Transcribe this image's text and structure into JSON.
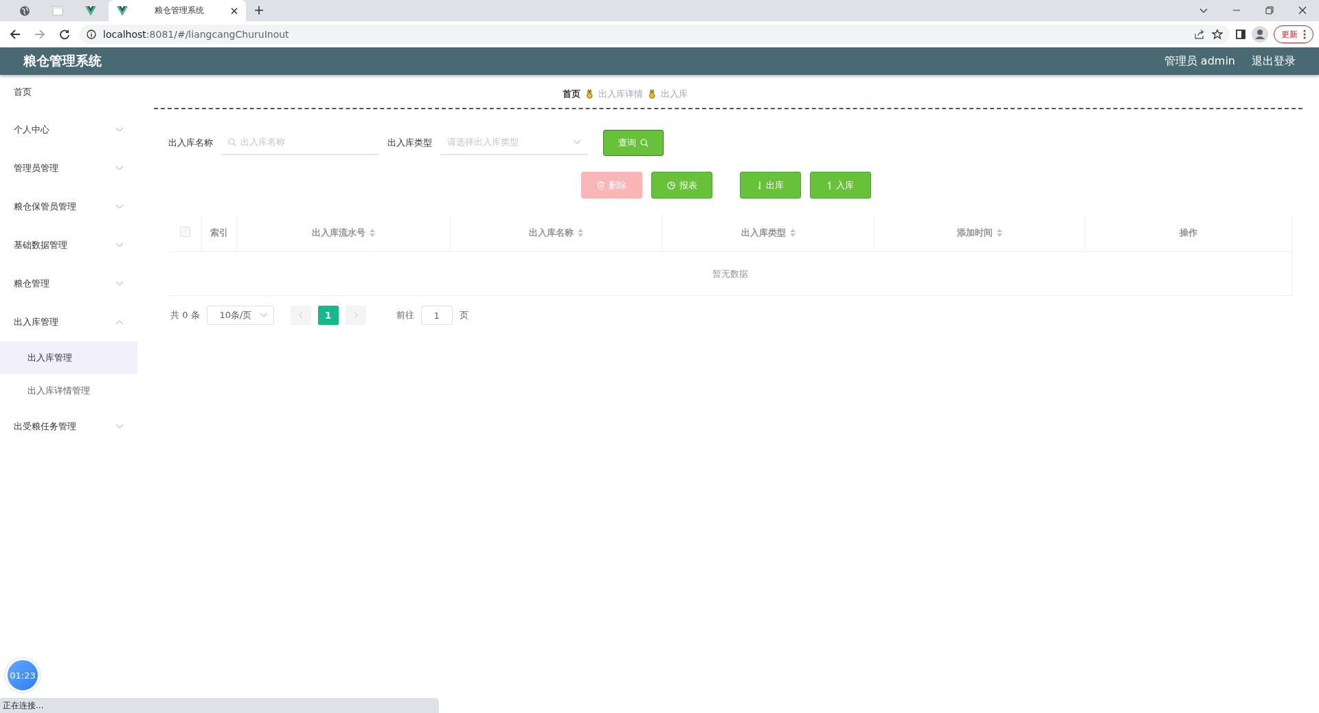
{
  "browser": {
    "tabs": [
      {
        "kind": "globe",
        "selected": false
      },
      {
        "kind": "page",
        "selected": false
      },
      {
        "kind": "vue",
        "selected": false
      },
      {
        "kind": "vue",
        "title": "粮仓管理系统",
        "selected": true
      }
    ],
    "url_host": "localhost",
    "url_rest": ":8081/#/liangcangChuruInout",
    "update_button": "更新"
  },
  "header": {
    "title": "粮仓管理系统",
    "user": "管理员 admin",
    "logout": "退出登录"
  },
  "sidebar": {
    "items": [
      {
        "label": "首页",
        "kind": "link"
      },
      {
        "label": "个人中心",
        "kind": "submenu",
        "expanded": false
      },
      {
        "label": "管理员管理",
        "kind": "submenu",
        "expanded": false
      },
      {
        "label": "粮仓保管员管理",
        "kind": "submenu",
        "expanded": false
      },
      {
        "label": "基础数据管理",
        "kind": "submenu",
        "expanded": false
      },
      {
        "label": "粮仓管理",
        "kind": "submenu",
        "expanded": false
      },
      {
        "label": "出入库管理",
        "kind": "submenu",
        "expanded": true,
        "children": [
          {
            "label": "出入库管理",
            "selected": true
          },
          {
            "label": "出入库详情管理",
            "selected": false
          }
        ]
      },
      {
        "label": "出受粮任务管理",
        "kind": "submenu",
        "expanded": false
      }
    ]
  },
  "breadcrumb": [
    "首页",
    "出入库详情",
    "出入库"
  ],
  "search": {
    "fields": [
      {
        "label": "出入库名称",
        "kind": "text",
        "placeholder": "出入库名称"
      },
      {
        "label": "出入库类型",
        "kind": "select",
        "placeholder": "请选择出入库类型"
      }
    ],
    "query_button": "查询"
  },
  "actions": [
    {
      "label": "删除",
      "kind": "delete",
      "disabled": true
    },
    {
      "label": "报表",
      "kind": "report",
      "disabled": false
    },
    {
      "label": "出库",
      "kind": "out",
      "disabled": false
    },
    {
      "label": "入库",
      "kind": "in",
      "disabled": false
    }
  ],
  "table": {
    "columns": [
      {
        "label": "索引",
        "sortable": false
      },
      {
        "label": "出入库流水号",
        "sortable": true
      },
      {
        "label": "出入库名称",
        "sortable": true
      },
      {
        "label": "出入库类型",
        "sortable": true
      },
      {
        "label": "添加时间",
        "sortable": true
      },
      {
        "label": "操作",
        "sortable": false
      }
    ],
    "empty_text": "暂无数据",
    "select_all_checked": false
  },
  "pagination": {
    "total": "共 0 条",
    "page_size": "10条/页",
    "pages": [
      {
        "label": "1",
        "selected": true
      }
    ],
    "goto_label": "前往",
    "goto_value": "1",
    "page_unit": "页"
  },
  "timer": "01:23",
  "status_bar": "正在连接..."
}
